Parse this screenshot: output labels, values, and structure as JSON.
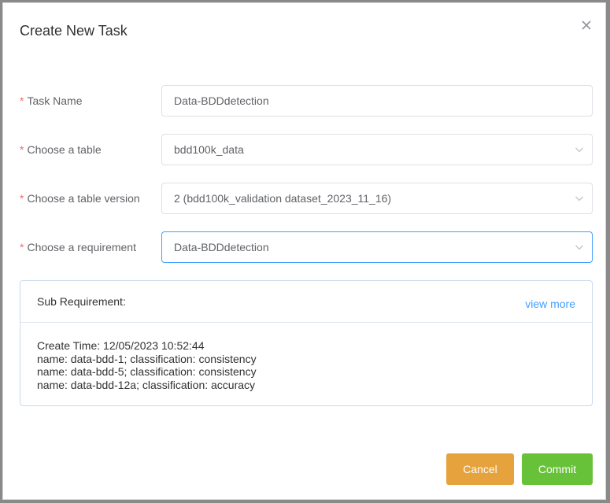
{
  "dialog": {
    "title": "Create New Task",
    "close_icon": "close-icon"
  },
  "form": {
    "required_marker": "*",
    "task_name": {
      "label": "Task Name",
      "value": "Data-BDDdetection"
    },
    "table": {
      "label": "Choose a table",
      "value": "bdd100k_data"
    },
    "table_version": {
      "label": "Choose a table version",
      "value": "2 (bdd100k_validation dataset_2023_11_16)"
    },
    "requirement": {
      "label": "Choose a requirement",
      "value": "Data-BDDdetection"
    }
  },
  "sub_requirement": {
    "title": "Sub Requirement:",
    "view_more": "view more",
    "lines": [
      "Create Time: 12/05/2023 10:52:44",
      "name: data-bdd-1; classification: consistency",
      "name: data-bdd-5; classification: consistency",
      "name: data-bdd-12a; classification: accuracy"
    ]
  },
  "buttons": {
    "cancel": "Cancel",
    "commit": "Commit"
  },
  "colors": {
    "accent": "#409eff",
    "required": "#f56c6c",
    "cancel": "#e6a23c",
    "commit": "#67c23a"
  }
}
